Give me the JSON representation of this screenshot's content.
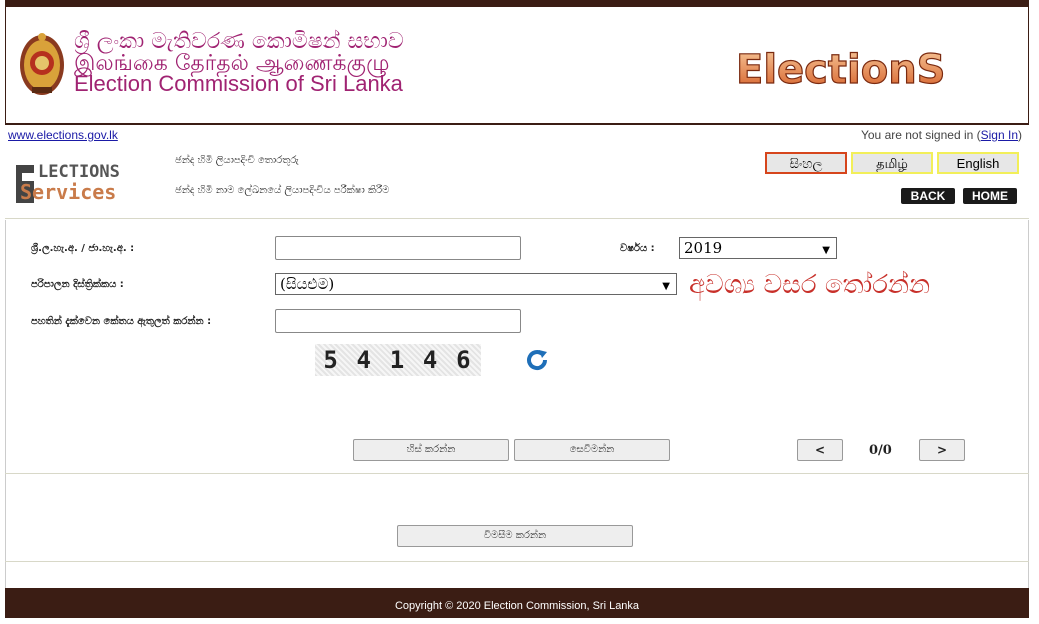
{
  "header": {
    "title_si": "ශ්‍රී ලංකා මැතිවරණ කොමිෂන් සභාව",
    "title_ta": "இலங்கை தேர்தல் ஆணைக்குழு",
    "title_en": "Election Commission of Sri Lanka",
    "logo_text": "ElectionS"
  },
  "topline": {
    "url": "www.elections.gov.lk",
    "signed_prefix": "You are not signed in (",
    "sign_in": "Sign In",
    "signed_suffix": ")"
  },
  "services": {
    "logo_top": "LECTIONS",
    "logo_bottom": "Services",
    "nav1": "ඡන්ද හිමි ලියාපදිංචි තොරතුරු",
    "nav2": "ඡන්ද හිමි නාම ලේඛනයේ ලියාපදිංචිය පරීක්ෂා කිරීම"
  },
  "lang": {
    "si": "සිංහල",
    "ta": "தமிழ்",
    "en": "English"
  },
  "nav": {
    "back": "BACK",
    "home": "HOME"
  },
  "form": {
    "nic_label": "ශ්‍රී.ල.හැ.අ. / ජා.හැ.අ. :",
    "year_label": "වර්ෂය :",
    "year_value": "2019",
    "district_label": "පරිපාලන දිස්ත්‍රික්කය :",
    "district_value": "(සියළුම)",
    "captcha_label": "පහතින් දැක්වෙන කේතය ඇතුලත් කරන්න :",
    "red_note": "අවශ්‍ය වසර තෝරන්න",
    "captcha_code": [
      "5",
      "4",
      "1",
      "4",
      "6"
    ]
  },
  "buttons": {
    "clear": "හිස් කරන්න",
    "search": "සෙවීමන්න",
    "prev": "<",
    "next": ">",
    "page": "0/0",
    "inquiry": "විමසීම කරන්න"
  },
  "footer": {
    "text": "Copyright © 2020 Election Commission, Sri Lanka"
  },
  "colors": {
    "brand": "#3b1d14",
    "title": "#a02372",
    "note": "#c8302a"
  }
}
